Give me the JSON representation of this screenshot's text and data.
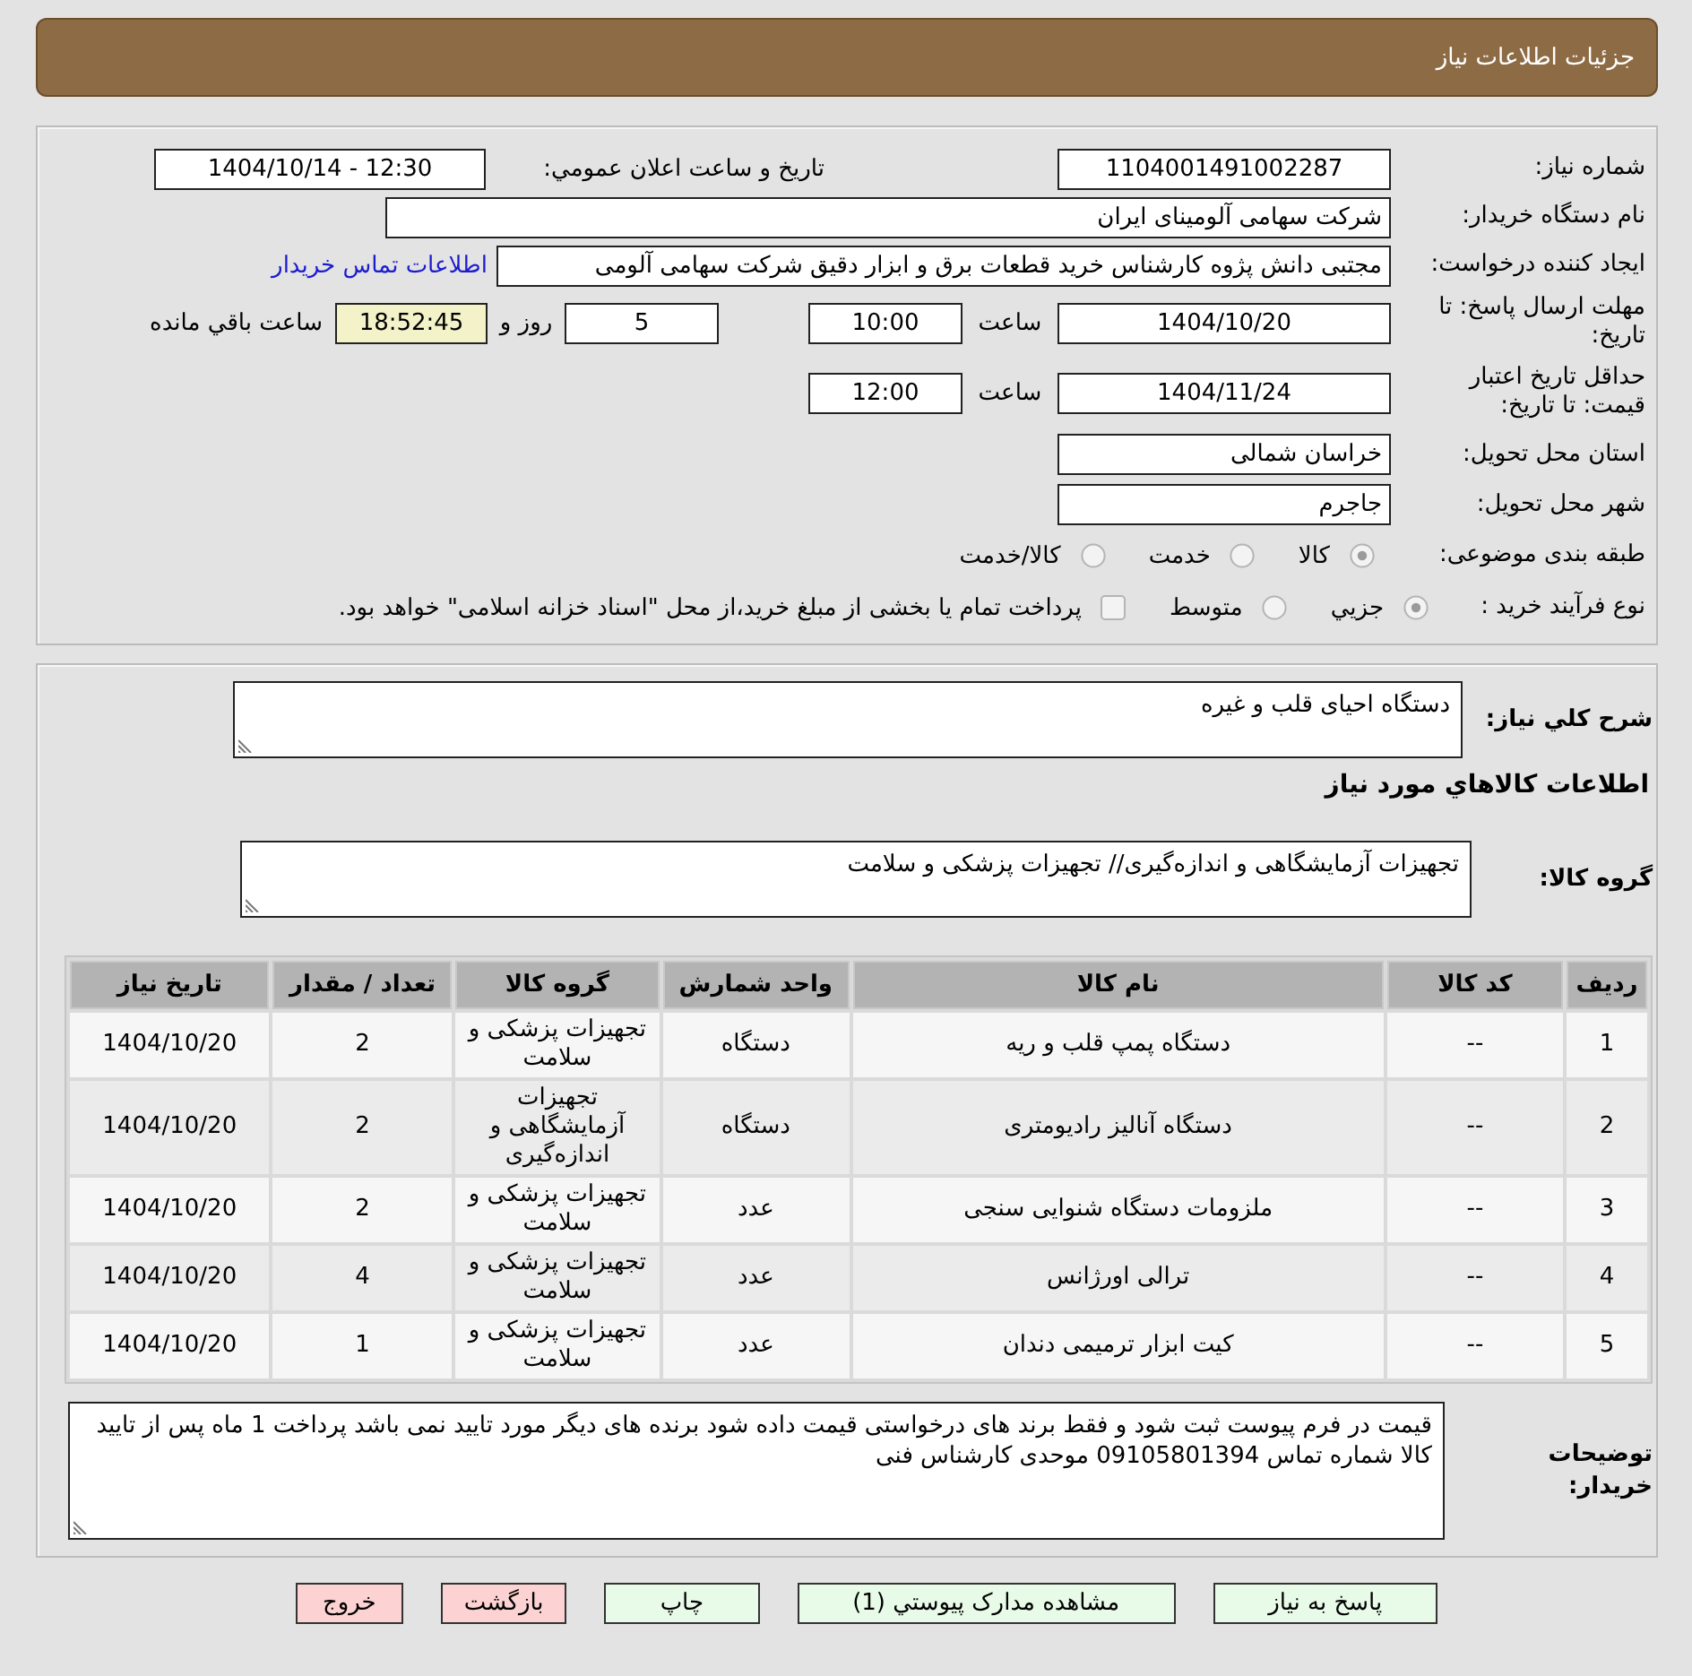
{
  "header": {
    "title": "جزئیات اطلاعات نیاز"
  },
  "details": {
    "need_number": {
      "label": "شماره نیاز:",
      "value": "1104001491002287"
    },
    "announcement": {
      "label": "تاریخ و ساعت اعلان عمومي:",
      "value": "1404/10/14 - 12:30"
    },
    "buyer": {
      "label": "نام دستگاه خریدار:",
      "value": "شرکت سهامی آلومینای ایران"
    },
    "requester": {
      "label": "ایجاد کننده درخواست:",
      "value": "مجتبی دانش پژوه کارشناس خرید قطعات برق و ابزار دقیق شرکت سهامی آلومی",
      "link": "اطلاعات تماس خریدار"
    },
    "deadline": {
      "label": "مهلت ارسال پاسخ: تا تاریخ:",
      "date": "1404/10/20",
      "time_label": "ساعت",
      "time": "10:00",
      "days": "5",
      "days_label": "روز و",
      "remaining": "18:52:45",
      "remaining_label": "ساعت باقي مانده"
    },
    "validity": {
      "label": "حداقل تاریخ اعتبار قیمت: تا تاریخ:",
      "date": "1404/11/24",
      "time_label": "ساعت",
      "time": "12:00"
    },
    "province": {
      "label": "استان محل تحویل:",
      "value": "خراسان شمالی"
    },
    "city": {
      "label": "شهر محل تحویل:",
      "value": "جاجرم"
    },
    "category": {
      "label": "طبقه بندی موضوعی:",
      "options": [
        {
          "label": "کالا",
          "selected": true
        },
        {
          "label": "خدمت",
          "selected": false
        },
        {
          "label": "کالا/خدمت",
          "selected": false
        }
      ]
    },
    "process": {
      "label": "نوع فرآیند خرید :",
      "options": [
        {
          "label": "جزيي",
          "selected": true
        },
        {
          "label": "متوسط",
          "selected": false
        }
      ],
      "treasury": {
        "label": "پرداخت تمام یا بخشی از مبلغ خرید،از محل \"اسناد خزانه اسلامی\" خواهد بود.",
        "checked": false
      }
    }
  },
  "needs": {
    "summary_label": "شرح کلي نياز:",
    "summary": "دستگاه احیای قلب و غیره",
    "section_title": "اطلاعات کالاهاي مورد نياز",
    "group_label": "گروه کالا:",
    "group": "تجهیزات آزمایشگاهی و اندازه‌گیری// تجهیزات پزشکی و سلامت"
  },
  "table": {
    "columns": [
      "ردیف",
      "کد کالا",
      "نام کالا",
      "واحد شمارش",
      "گروه کالا",
      "تعداد / مقدار",
      "تاریخ نیاز"
    ],
    "rows": [
      [
        "1",
        "--",
        "دستگاه پمپ قلب و ریه",
        "دستگاه",
        "تجهیزات پزشکی و سلامت",
        "2",
        "1404/10/20"
      ],
      [
        "2",
        "--",
        "دستگاه آنالیز رادیومتری",
        "دستگاه",
        "تجهیزات آزمایشگاهی و اندازه‌گیری",
        "2",
        "1404/10/20"
      ],
      [
        "3",
        "--",
        "ملزومات دستگاه شنوایی سنجی",
        "عدد",
        "تجهیزات پزشکی و سلامت",
        "2",
        "1404/10/20"
      ],
      [
        "4",
        "--",
        "ترالی اورژانس",
        "عدد",
        "تجهیزات پزشکی و سلامت",
        "4",
        "1404/10/20"
      ],
      [
        "5",
        "--",
        "کیت ابزار ترمیمی دندان",
        "عدد",
        "تجهیزات پزشکی و سلامت",
        "1",
        "1404/10/20"
      ]
    ]
  },
  "buyer_notes": {
    "label": "توضیحات خریدار:",
    "text": "قیمت در فرم پیوست ثبت شود و فقط برند های درخواستی قیمت داده شود برنده های دیگر مورد تایید نمی باشد پرداخت 1 ماه پس از تایید کالا شماره تماس 09105801394 موحدی کارشناس فنی"
  },
  "buttons": [
    {
      "label": "پاسخ به نیاز",
      "kind": "confirm"
    },
    {
      "label": "مشاهده مدارک پیوستي (1)",
      "kind": "confirm"
    },
    {
      "label": "چاپ",
      "kind": "confirm"
    },
    {
      "label": "بازگشت",
      "kind": "cancel"
    },
    {
      "label": "خروج",
      "kind": "cancel"
    }
  ]
}
